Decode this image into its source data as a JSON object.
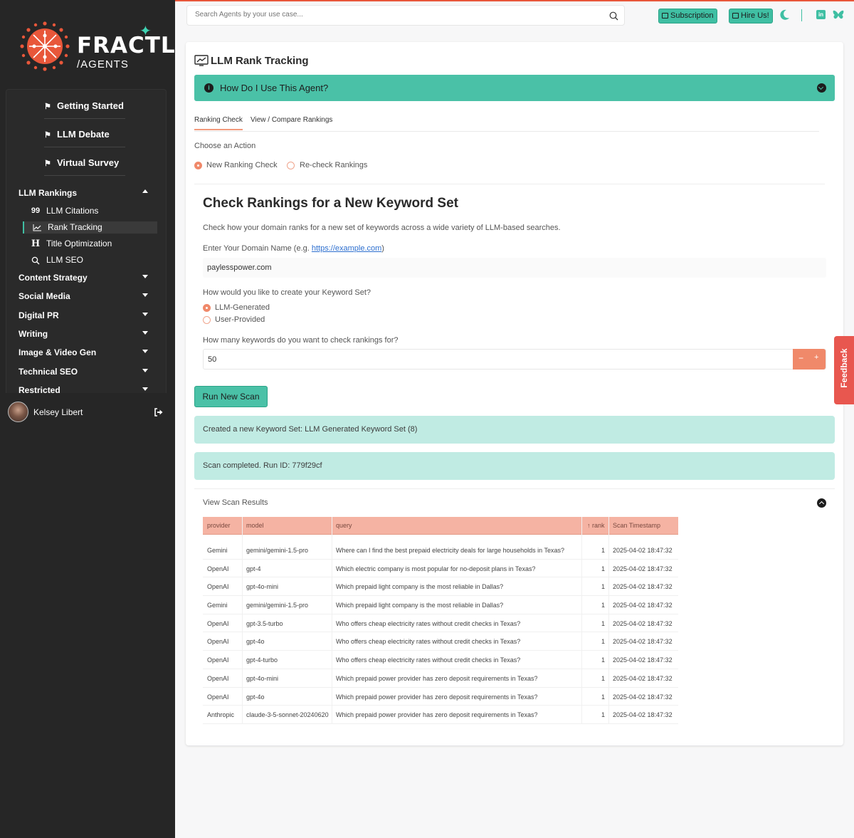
{
  "brand": {
    "word": "FRACTL",
    "sub": "/AGENTS"
  },
  "colors": {
    "accent_teal": "#3fbfa3",
    "accent_orange": "#e8573a",
    "sidebar_bg": "#262626"
  },
  "sidebar": {
    "top_items": [
      {
        "label": "Getting Started",
        "icon": "flag-icon"
      },
      {
        "label": "LLM Debate",
        "icon": "flag-icon"
      },
      {
        "label": "Virtual Survey",
        "icon": "flag-icon"
      }
    ],
    "groups": [
      {
        "label": "LLM Rankings",
        "expanded": true
      },
      {
        "label": "Content Strategy"
      },
      {
        "label": "Social Media"
      },
      {
        "label": "Digital PR"
      },
      {
        "label": "Writing"
      },
      {
        "label": "Image & Video Gen"
      },
      {
        "label": "Technical SEO"
      },
      {
        "label": "Restricted"
      }
    ],
    "sub_items": [
      {
        "label": "LLM Citations",
        "icon_glyph": "99"
      },
      {
        "label": "Rank Tracking",
        "active": true
      },
      {
        "label": "Title Optimization",
        "icon_glyph": "H"
      },
      {
        "label": "LLM SEO"
      }
    ],
    "user": {
      "name": "Kelsey Libert"
    }
  },
  "topbar": {
    "search_placeholder": "Search Agents by your use case...",
    "subscription_label": "Subscription",
    "hire_label": "Hire Us!"
  },
  "main": {
    "title": "LLM Rank Tracking",
    "how_to": "How Do I Use This Agent?",
    "tabs": [
      {
        "label": "Ranking Check",
        "active": true
      },
      {
        "label": "View / Compare Rankings"
      }
    ],
    "choose_action": "Choose an Action",
    "actions": [
      {
        "label": "New Ranking Check",
        "selected": true
      },
      {
        "label": "Re-check Rankings"
      }
    ],
    "section_title": "Check Rankings for a New Keyword Set",
    "section_desc": "Check how your domain ranks for a new set of keywords across a wide variety of LLM-based searches.",
    "domain_label": "Enter Your Domain Name (e.g. ",
    "domain_example": "https://example.com",
    "domain_label_end": ")",
    "domain_value": "paylesspower.com",
    "keyword_question": "How would you like to create your Keyword Set?",
    "keyword_options": [
      {
        "label": "LLM-Generated",
        "selected": true
      },
      {
        "label": "User-Provided"
      }
    ],
    "count_question": "How many keywords do you want to check rankings for?",
    "count_value": "50",
    "run_label": "Run New Scan",
    "alerts": [
      "Created a new Keyword Set: LLM Generated Keyword Set (8)",
      "Scan completed. Run ID: 779f29cf"
    ],
    "results_title": "View Scan Results",
    "table": {
      "columns": [
        "provider",
        "model",
        "query",
        "↑ rank",
        "Scan Timestamp"
      ],
      "rows": [
        [
          "Gemini",
          "gemini/gemini-1.5-pro",
          "Where can I find the best prepaid electricity deals for large households in Texas?",
          "1",
          "2025-04-02 18:47:32"
        ],
        [
          "OpenAI",
          "gpt-4",
          "Which electric company is most popular for no-deposit plans in Texas?",
          "1",
          "2025-04-02 18:47:32"
        ],
        [
          "OpenAI",
          "gpt-4o-mini",
          "Which prepaid light company is the most reliable in Dallas?",
          "1",
          "2025-04-02 18:47:32"
        ],
        [
          "Gemini",
          "gemini/gemini-1.5-pro",
          "Which prepaid light company is the most reliable in Dallas?",
          "1",
          "2025-04-02 18:47:32"
        ],
        [
          "OpenAI",
          "gpt-3.5-turbo",
          "Who offers cheap electricity rates without credit checks in Texas?",
          "1",
          "2025-04-02 18:47:32"
        ],
        [
          "OpenAI",
          "gpt-4o",
          "Who offers cheap electricity rates without credit checks in Texas?",
          "1",
          "2025-04-02 18:47:32"
        ],
        [
          "OpenAI",
          "gpt-4-turbo",
          "Who offers cheap electricity rates without credit checks in Texas?",
          "1",
          "2025-04-02 18:47:32"
        ],
        [
          "OpenAI",
          "gpt-4o-mini",
          "Which prepaid power provider has zero deposit requirements in Texas?",
          "1",
          "2025-04-02 18:47:32"
        ],
        [
          "OpenAI",
          "gpt-4o",
          "Which prepaid power provider has zero deposit requirements in Texas?",
          "1",
          "2025-04-02 18:47:32"
        ],
        [
          "Anthropic",
          "claude-3-5-sonnet-20240620",
          "Which prepaid power provider has zero deposit requirements in Texas?",
          "1",
          "2025-04-02 18:47:32"
        ]
      ]
    }
  },
  "feedback_label": "Feedback"
}
